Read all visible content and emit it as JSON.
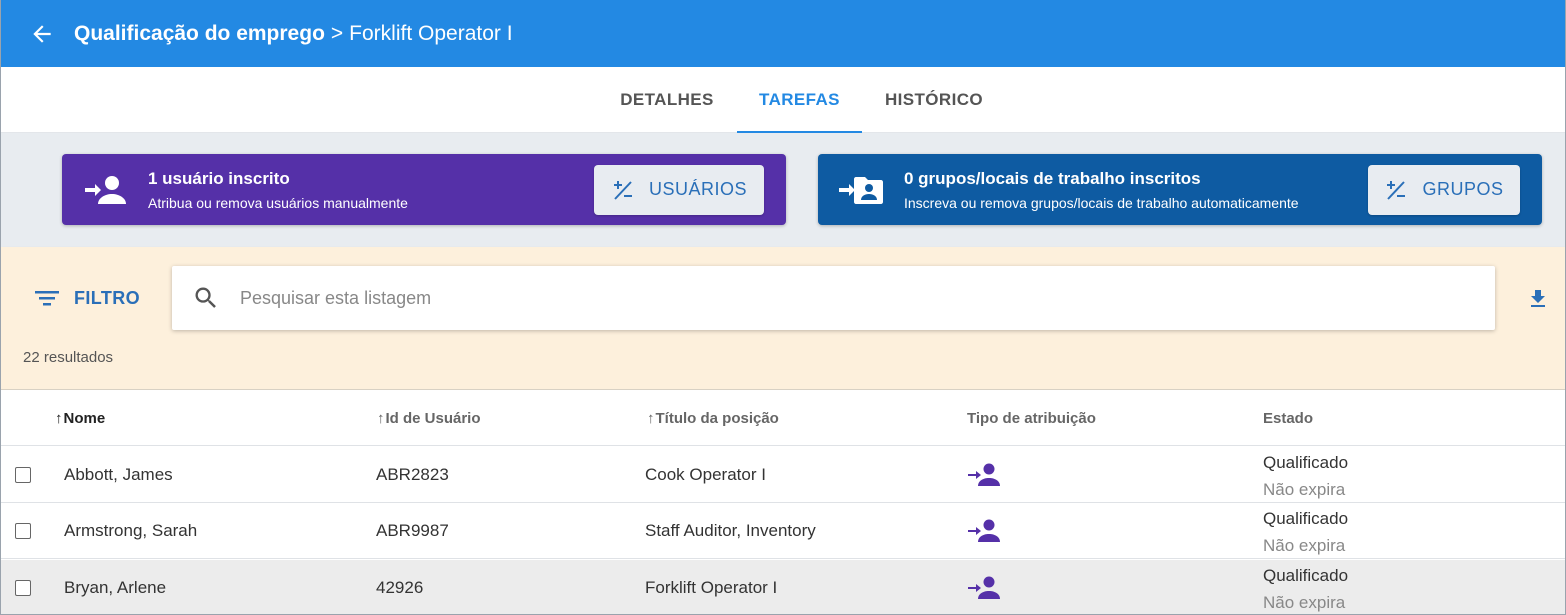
{
  "header": {
    "title": "Qualificação do emprego",
    "separator": ">",
    "subtitle": "Forklift Operator I"
  },
  "tabs": [
    {
      "label": "DETALHES",
      "active": false
    },
    {
      "label": "TAREFAS",
      "active": true
    },
    {
      "label": "HISTÓRICO",
      "active": false
    }
  ],
  "enroll": {
    "users": {
      "title": "1 usuário inscrito",
      "subtitle": "Atribua ou remova usuários manualmente",
      "button": "USUÁRIOS",
      "color": "#5530a8"
    },
    "groups": {
      "title": "0 grupos/locais de trabalho inscritos",
      "subtitle": "Inscreva ou remova grupos/locais de trabalho automaticamente",
      "button": "GRUPOS",
      "color": "#0e5ba2"
    }
  },
  "filter": {
    "label": "FILTRO",
    "search_placeholder": "Pesquisar esta listagem",
    "search_value": "",
    "results": "22 resultados"
  },
  "table": {
    "columns": [
      {
        "label": "Nome",
        "sort_arrow": "↑",
        "sorted": true
      },
      {
        "label": "Id de Usuário",
        "sort_arrow": "↑",
        "sorted": false
      },
      {
        "label": "Título da posição",
        "sort_arrow": "↑",
        "sorted": false
      },
      {
        "label": "Tipo de atribuição",
        "sort_arrow": "",
        "sorted": false
      },
      {
        "label": "Estado",
        "sort_arrow": "",
        "sorted": false
      }
    ],
    "rows": [
      {
        "name": "Abbott, James",
        "user_id": "ABR2823",
        "position": "Cook Operator I",
        "assignment_icon": "person-add-icon",
        "status": "Qualificado",
        "expiry": "Não expira",
        "checked": false,
        "highlighted": false
      },
      {
        "name": "Armstrong, Sarah",
        "user_id": "ABR9987",
        "position": "Staff Auditor, Inventory",
        "assignment_icon": "person-add-icon",
        "status": "Qualificado",
        "expiry": "Não expira",
        "checked": false,
        "highlighted": false
      },
      {
        "name": "Bryan, Arlene",
        "user_id": "42926",
        "position": "Forklift Operator I",
        "assignment_icon": "person-add-icon",
        "status": "Qualificado",
        "expiry": "Não expira",
        "checked": false,
        "highlighted": true
      }
    ]
  },
  "colors": {
    "primary": "#2389e3",
    "assignment_icon": "#5530a8"
  }
}
